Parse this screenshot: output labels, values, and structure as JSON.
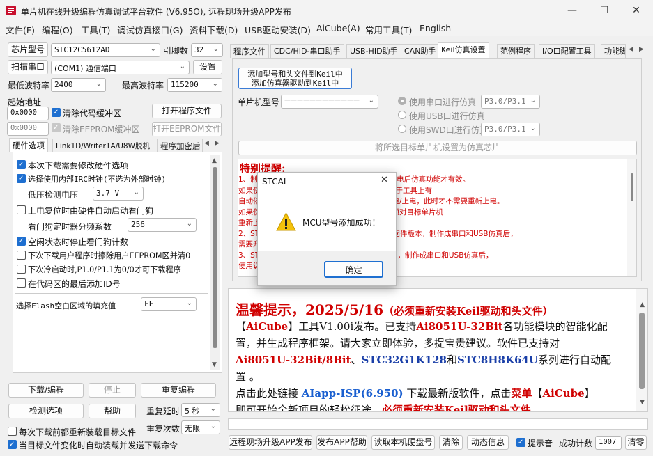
{
  "window": {
    "title": "单片机在线升级编程仿真调试平台软件 (V6.95O), 远程现场升级APP发布",
    "minimize": "—",
    "maximize": "☐",
    "close": "✕"
  },
  "menu": [
    "文件(F)",
    "编程(O)",
    "工具(T)",
    "调试仿真接口(G)",
    "资料下载(D)",
    "USB驱动安装(D)",
    "AiCube(A)",
    "常用工具(T)",
    "English"
  ],
  "left": {
    "chip_label": "芯片型号",
    "chip_value": "STC12C5612AD",
    "pin_label": "引脚数",
    "pin_value": "32",
    "scan_button": "扫描串口",
    "port_value": "(COM1) 通信端口",
    "settings_button": "设置",
    "min_baud_label": "最低波特率",
    "min_baud_value": "2400",
    "max_baud_label": "最高波特率",
    "max_baud_value": "115200",
    "start_addr_label": "起始地址",
    "addr1_value": "0x0000",
    "clear_code_label": "清除代码缓冲区",
    "open_program_button": "打开程序文件",
    "addr2_value": "0x0000",
    "clear_eeprom_label": "清除EEPROM缓冲区",
    "open_eeprom_button": "打开EEPROM文件",
    "tabs": [
      "硬件选项",
      "Link1D/Writer1A/U8W脱机",
      "程序加密后"
    ],
    "hw_options": {
      "opt1": "本次下载需要修改硬件选项",
      "opt2": "选择使用内部IRC时钟(不选为外部时钟)",
      "low_voltage_label": "低压检测电压",
      "low_voltage_value": "3.7 V",
      "opt3": "上电复位时由硬件自动启动看门狗",
      "wdt_label": "看门狗定时器分频系数",
      "wdt_value": "256",
      "opt4": "空闲状态时停止看门狗计数",
      "opt5": "下次下载用户程序时擦除用户EEPROM区并清0",
      "opt6": "下次冷启动时,P1.0/P1.1为0/0才可下载程序",
      "opt7": "在代码区的最后添加ID号",
      "fill_label": "选择Flash空白区域的填充值",
      "fill_value": "FF"
    },
    "download_button": "下载/编程",
    "stop_button": "停止",
    "reprogram_button": "重复编程",
    "check_button": "检测选项",
    "help_button": "帮助",
    "repeat_delay_label": "重复延时",
    "repeat_delay_value": "5 秒",
    "repeat_count_label": "重复次数",
    "repeat_count_value": "无限",
    "reload_label": "每次下载前都重新装载目标文件",
    "auto_load_label": "当目标文件变化时自动装载并发送下载命令"
  },
  "right": {
    "tabs": [
      "程序文件",
      "CDC/HID-串口助手",
      "USB-HID助手",
      "CAN助手",
      "Keil仿真设置",
      "范例程序",
      "I/O口配置工具",
      "功能脚"
    ],
    "keil": {
      "add_button_line1": "添加型号和头文件到Keil中",
      "add_button_line2": "添加仿真器驱动到Keil中",
      "mcu_label": "单片机型号",
      "mcu_value": "————————————",
      "radio1": "使用串口进行仿真",
      "radio1_port": "P3.0/P3.1",
      "radio2": "使用USB口进行仿真",
      "radio3": "使用SWD口进行仿真",
      "radio3_port": "P3.0/P3.1",
      "set_sim_button": "将所选目标单片机设置为仿真芯片"
    },
    "notice": {
      "title": "特别提醒:",
      "lines": [
        "1、制作仿真芯片时，需要重新上电，并在重新上电后仿真功能才有效。",
        "    如果使用U8W/U8-Mini等工具制作仿真芯片，由于工具上有",
        "    自动停电功能，工具会在制作完成后自动进行停电/上电，此时才不需要重新上电。",
        "    如果使用串口工具制作仿真芯片，制作完成后必须对目标单片机",
        "    重新上电，才能正确进行仿真。",
        "2、STC8H系列的芯片，如果是7.4.13及之前的固件版本，制作成串口和USB仿真后，",
        "    需要升级固件。",
        "3、STC32G系列的芯片，如果是7.4.13固件版本，制作成串口和USB仿真后，",
        "    使用调试仿真接口更新到7.4.14版本"
      ]
    },
    "tip": {
      "title": "温馨提示，2025/5/16",
      "title_note": "（必须重新安装Keil驱动和头文件）",
      "p1a": "【",
      "p1b": "AiCube",
      "p1c": "】工具V1.00i发布。已支持",
      "p1d": "Ai8051U-32Bit",
      "p1e": "各功能模块的智能化配置，并生成程序框架。请大家立即体验，多提宝贵建议。软件已支持对",
      "p2a": "Ai8051U-32Bit/8Bit",
      "p2b": "、",
      "p2c": "STC32G1K128",
      "p2d": "和",
      "p2e": "STC8H8K64U",
      "p2f": "系列进行自动配置 。",
      "p3a": "点击此处链接 ",
      "p3b": "AIapp-ISP(6.950)",
      "p3c": " 下载最新版软件，点击",
      "p3d": "菜单",
      "p3e": "【",
      "p3f": "AiCube",
      "p3g": "】",
      "p4a": "即可开始全新项目的轻松征途。",
      "p4b": "必须重新安装Keil驱动和头文件"
    },
    "bottom": {
      "remote_button": "远程现场升级APP发布",
      "publish_help_button": "发布APP帮助",
      "read_disk_button": "读取本机硬盘号",
      "clear_button": "清除",
      "dynamic_button": "动态信息",
      "sound_label": "提示音",
      "success_label": "成功计数",
      "success_value": "1007",
      "clear_count_button": "清零"
    }
  },
  "dialog": {
    "title": "STCAI",
    "message": "MCU型号添加成功！",
    "ok_button": "确定",
    "close": "✕"
  }
}
